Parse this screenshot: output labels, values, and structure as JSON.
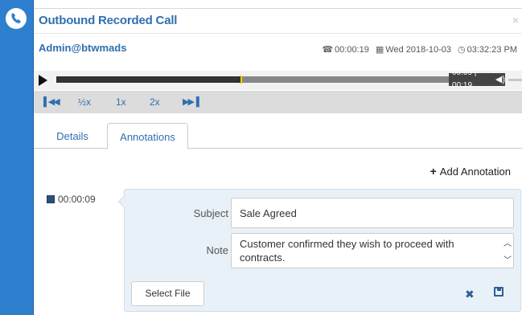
{
  "window": {
    "title": "Outbound Recorded Call",
    "close_label": "×"
  },
  "call": {
    "user": "Admin@btwmads",
    "duration": "00:00:19",
    "date": "Wed 2018-10-03",
    "time": "03:32:23 PM"
  },
  "player": {
    "elapsed": "00:09",
    "total": "00:19",
    "time_display": "00:09 | 00:19",
    "progress": 0.47
  },
  "speed_controls": {
    "rewind_icon": "skip-back-icon",
    "half": "½x",
    "one": "1x",
    "two": "2x",
    "forward_icon": "skip-forward-icon"
  },
  "tabs": [
    {
      "label": "Details",
      "active": false
    },
    {
      "label": "Annotations",
      "active": true
    }
  ],
  "annotations": {
    "add_label": "Add Annotation",
    "items": [
      {
        "timestamp": "00:00:09",
        "subject_label": "Subject",
        "subject": "Sale Agreed",
        "note_label": "Note",
        "note": "Customer confirmed they wish to proceed with contracts.",
        "select_file_label": "Select File"
      }
    ]
  },
  "colors": {
    "accent": "#2f6fb0",
    "sidebar": "#2f7fcf",
    "panel": "#e9f1f8"
  }
}
